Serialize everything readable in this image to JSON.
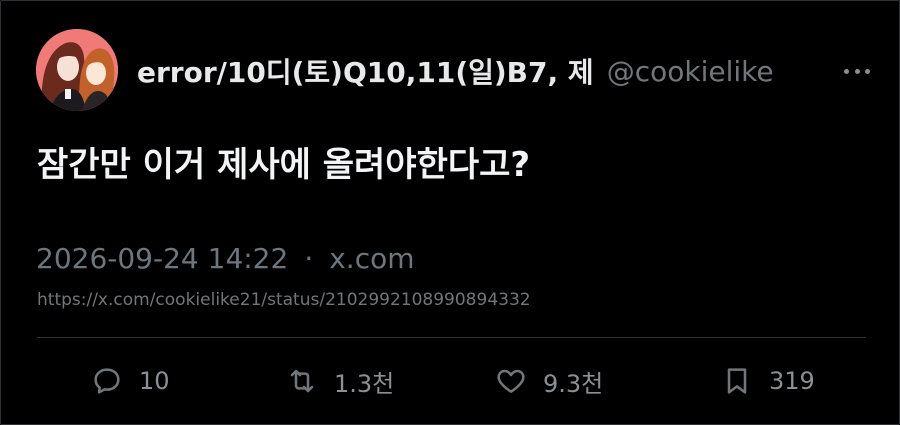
{
  "tweet": {
    "display_name": "error/10디(토)Q10,11(일)B7, 제",
    "handle": "@cookielike",
    "text": "잠간만 이거 제사에 올려야한다고?",
    "timestamp": "2026-09-24 14:22",
    "separator": "·",
    "source": "x.com",
    "url": "https://x.com/cookielike21/status/2102992108990894332"
  },
  "actions": {
    "replies": "10",
    "retweets": "1.3천",
    "likes": "9.3천",
    "bookmarks": "319"
  },
  "icons": {
    "more": "more-horizontal-icon",
    "reply": "reply-icon",
    "retweet": "retweet-icon",
    "like": "heart-icon",
    "bookmark": "bookmark-icon"
  },
  "colors": {
    "background": "#000000",
    "text": "#e7e9ea",
    "muted": "#71767b",
    "avatar_bg": "#f07f7f"
  }
}
